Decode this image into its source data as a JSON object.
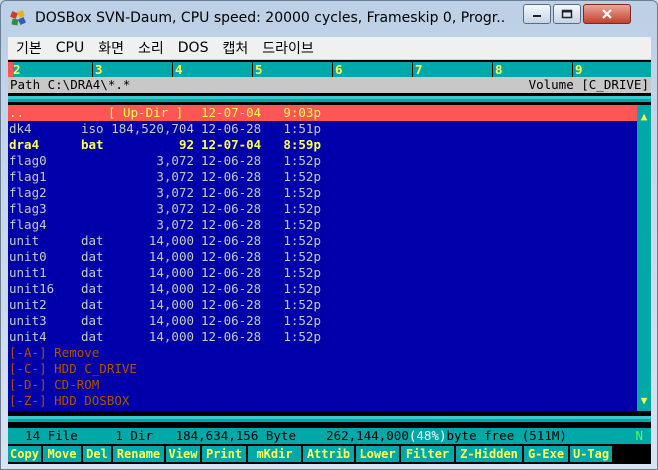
{
  "window": {
    "title": "DOSBox SVN-Daum, CPU speed:    20000 cycles, Frameskip  0, Progr...",
    "icon": "dosbox-icon"
  },
  "menu": [
    "기본",
    "CPU",
    "화면",
    "소리",
    "DOS",
    "캡처",
    "드라이브"
  ],
  "drive_tabs": [
    "2",
    "3",
    "4",
    "5",
    "6",
    "7",
    "8",
    "9"
  ],
  "path": {
    "label": "Path C:\\DRA4\\*.*",
    "volume": "Volume [C_DRIVE]"
  },
  "files": [
    {
      "name": "..",
      "ext": "",
      "size": "[ Up-Dir ]",
      "date": "12-07-04",
      "time": "9:03p",
      "type": "selected"
    },
    {
      "name": "dk4",
      "ext": "iso",
      "size": "184,520,704",
      "date": "12-06-28",
      "time": "1:51p",
      "type": "file"
    },
    {
      "name": "dra4",
      "ext": "bat",
      "size": "92",
      "date": "12-07-04",
      "time": "8:59p",
      "type": "exe"
    },
    {
      "name": "flag0",
      "ext": "",
      "size": "3,072",
      "date": "12-06-28",
      "time": "1:52p",
      "type": "file"
    },
    {
      "name": "flag1",
      "ext": "",
      "size": "3,072",
      "date": "12-06-28",
      "time": "1:52p",
      "type": "file"
    },
    {
      "name": "flag2",
      "ext": "",
      "size": "3,072",
      "date": "12-06-28",
      "time": "1:52p",
      "type": "file"
    },
    {
      "name": "flag3",
      "ext": "",
      "size": "3,072",
      "date": "12-06-28",
      "time": "1:52p",
      "type": "file"
    },
    {
      "name": "flag4",
      "ext": "",
      "size": "3,072",
      "date": "12-06-28",
      "time": "1:52p",
      "type": "file"
    },
    {
      "name": "unit",
      "ext": "dat",
      "size": "14,000",
      "date": "12-06-28",
      "time": "1:52p",
      "type": "file"
    },
    {
      "name": "unit0",
      "ext": "dat",
      "size": "14,000",
      "date": "12-06-28",
      "time": "1:52p",
      "type": "file"
    },
    {
      "name": "unit1",
      "ext": "dat",
      "size": "14,000",
      "date": "12-06-28",
      "time": "1:52p",
      "type": "file"
    },
    {
      "name": "unit16",
      "ext": "dat",
      "size": "14,000",
      "date": "12-06-28",
      "time": "1:52p",
      "type": "file"
    },
    {
      "name": "unit2",
      "ext": "dat",
      "size": "14,000",
      "date": "12-06-28",
      "time": "1:52p",
      "type": "file"
    },
    {
      "name": "unit3",
      "ext": "dat",
      "size": "14,000",
      "date": "12-06-28",
      "time": "1:52p",
      "type": "file"
    },
    {
      "name": "unit4",
      "ext": "dat",
      "size": "14,000",
      "date": "12-06-28",
      "time": "1:52p",
      "type": "file"
    }
  ],
  "drives": [
    "[-A-] Remove",
    "[-C-] HDD C_DRIVE",
    "[-D-] CD-ROM",
    "[-Z-] HDD DOSBOX"
  ],
  "status": {
    "text": "  14 File     1 Dir   184,634,156 Byte    262,144,000",
    "pct": "(48%)",
    "free": "byte free (511M)",
    "indicator": "N"
  },
  "function_keys": [
    "Copy",
    "Move",
    "Del",
    "Rename",
    "View",
    "Print",
    "mKdir",
    "Attrib",
    "Lower",
    "Filter",
    "Z-Hidden",
    "G-Exe",
    "U-Tag"
  ],
  "colors": {
    "screen_bg": "#000000",
    "list_bg": "#0000aa",
    "cyan": "#00a8a8",
    "selection": "#ff5555",
    "yellow": "#ffff55",
    "drive_brown": "#aa5500"
  }
}
